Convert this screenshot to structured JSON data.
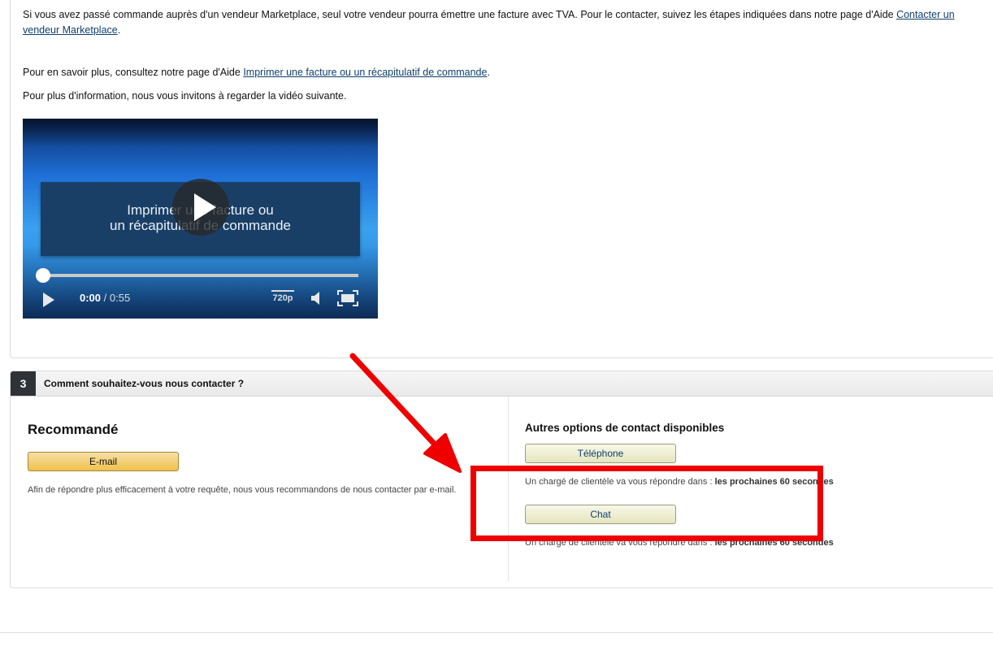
{
  "intro": {
    "marketplace_text": "Si vous avez passé commande auprès d'un vendeur Marketplace, seul votre vendeur pourra émettre une facture avec TVA. Pour le contacter, suivez les étapes indiquées dans notre page d'Aide ",
    "marketplace_link": "Contacter un vendeur Marketplace",
    "learn_more_text": "Pour en savoir plus, consultez notre page d'Aide ",
    "learn_more_link": "Imprimer une facture ou un récapitulatif de commande",
    "video_intro": "Pour plus d'information, nous vous invitons à regarder la vidéo suivante."
  },
  "video": {
    "title_line1": "Imprimer une facture ou",
    "title_line2": "un récapitulatif de commande",
    "current_time": "0:00",
    "duration": "/ 0:55",
    "quality": "720p",
    "progress": 0
  },
  "step3": {
    "number": "3",
    "title": "Comment souhaitez-vous nous contacter ?",
    "recommended": {
      "heading": "Recommandé",
      "email_button": "E-mail",
      "note": "Afin de répondre plus efficacement à votre requête, nous vous recommandons de nous contacter par e-mail."
    },
    "other": {
      "heading": "Autres options de contact disponibles",
      "phone_button": "Téléphone",
      "phone_note": "Un chargé de clientèle va vous répondre dans : ",
      "phone_note_bold": "les prochaines 60 secondes",
      "chat_button": "Chat",
      "chat_note": "Un chargé de clientèle va vous répondre dans : ",
      "chat_note_bold": "les prochaines 60 secondes"
    }
  },
  "annotation_color": "#ee0000",
  "primary_button_color": "#f0c14b",
  "link_color": "#0f3f6e"
}
